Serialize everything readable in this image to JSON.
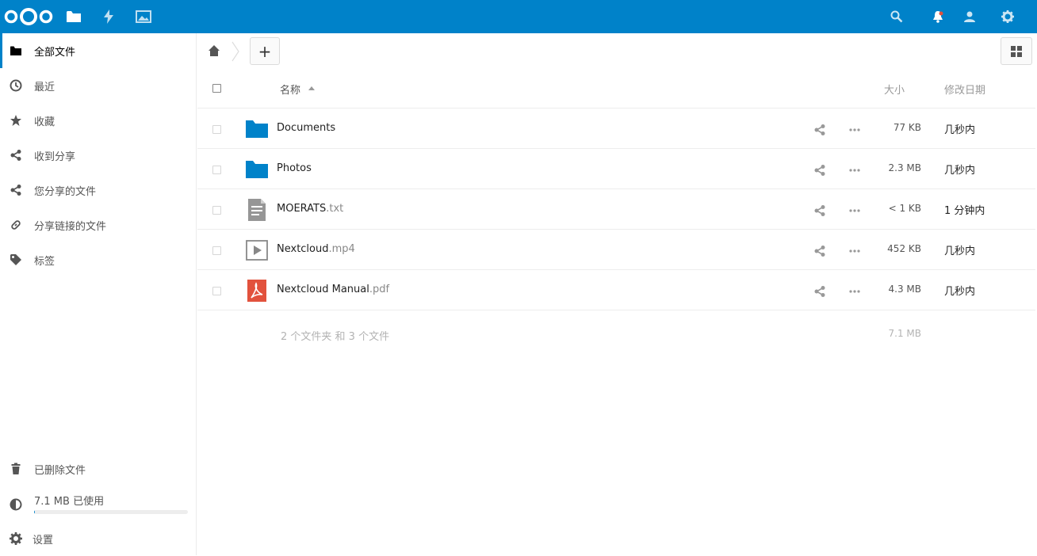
{
  "colors": {
    "brand": "#0082c9",
    "folder": "#0082c9",
    "pdf": "#e2523d",
    "text_icon": "#969696"
  },
  "header": {
    "apps": [
      {
        "name": "files",
        "icon": "folder-icon"
      },
      {
        "name": "activity",
        "icon": "lightning-icon"
      },
      {
        "name": "gallery",
        "icon": "image-icon"
      }
    ],
    "right": [
      "search-icon",
      "notifications-bell-icon",
      "contacts-icon",
      "settings-gear-icon"
    ]
  },
  "sidebar": {
    "items": [
      {
        "label": "全部文件",
        "icon": "folder-icon"
      },
      {
        "label": "最近",
        "icon": "clock-icon"
      },
      {
        "label": "收藏",
        "icon": "star-icon"
      },
      {
        "label": "收到分享",
        "icon": "share-icon"
      },
      {
        "label": "您分享的文件",
        "icon": "share-icon"
      },
      {
        "label": "分享链接的文件",
        "icon": "link-icon"
      },
      {
        "label": "标签",
        "icon": "tag-icon"
      }
    ],
    "trash": {
      "label": "已删除文件",
      "icon": "trash-icon"
    },
    "quota": {
      "label": "7.1 MB 已使用",
      "icon": "pie-chart-icon",
      "used_fraction": 0.001
    },
    "settings": {
      "label": "设置",
      "icon": "settings-gear-icon"
    }
  },
  "toolbar": {
    "new_label": "+",
    "view_icon": "grid-view-icon"
  },
  "table": {
    "headers": {
      "name": "名称",
      "size": "大小",
      "modified": "修改日期"
    },
    "rows": [
      {
        "name": "Documents",
        "ext": "",
        "type": "folder",
        "size": "77 KB",
        "modified": "几秒内"
      },
      {
        "name": "Photos",
        "ext": "",
        "type": "folder",
        "size": "2.3 MB",
        "modified": "几秒内"
      },
      {
        "name": "MOERATS",
        "ext": ".txt",
        "type": "text",
        "size": "< 1 KB",
        "modified": "1 分钟内"
      },
      {
        "name": "Nextcloud",
        "ext": ".mp4",
        "type": "video",
        "size": "452 KB",
        "modified": "几秒内"
      },
      {
        "name": "Nextcloud Manual",
        "ext": ".pdf",
        "type": "pdf",
        "size": "4.3 MB",
        "modified": "几秒内"
      }
    ],
    "summary": {
      "counts": "2 个文件夹 和 3 个文件",
      "total_size": "7.1 MB"
    }
  }
}
